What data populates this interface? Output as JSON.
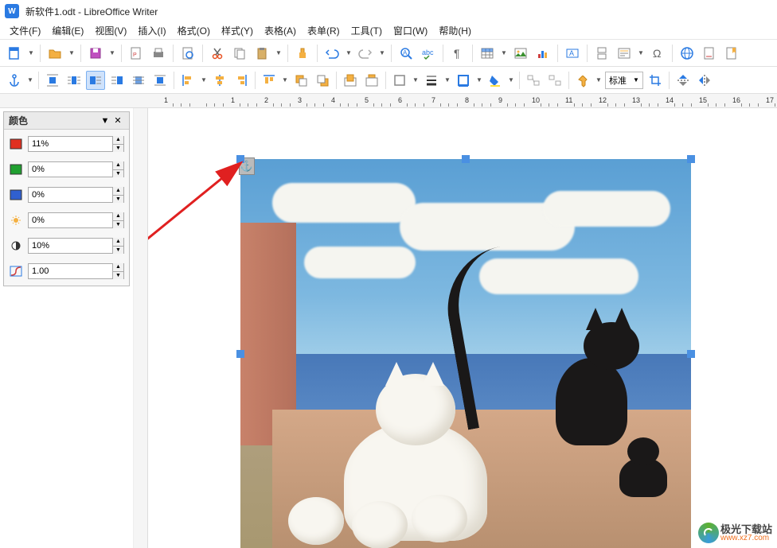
{
  "title": {
    "doc_name": "新软件1.odt",
    "app_name": "LibreOffice Writer",
    "separator": " - "
  },
  "menus": {
    "file": "文件(F)",
    "edit": "编辑(E)",
    "view": "视图(V)",
    "insert": "插入(I)",
    "format": "格式(O)",
    "styles": "样式(Y)",
    "table": "表格(A)",
    "form": "表单(R)",
    "tools": "工具(T)",
    "window": "窗口(W)",
    "help": "帮助(H)"
  },
  "toolbar2": {
    "combo_label": "标准"
  },
  "color_panel": {
    "title": "颜色",
    "red": "11%",
    "green": "0%",
    "blue": "0%",
    "brightness": "0%",
    "contrast": "10%",
    "gamma": "1.00"
  },
  "ruler": {
    "marks": [
      "1",
      "",
      "1",
      "2",
      "3",
      "4",
      "5",
      "6",
      "7",
      "8",
      "9",
      "10",
      "11",
      "12",
      "13",
      "14",
      "15",
      "16",
      "17"
    ]
  },
  "watermark": {
    "name": "极光下载站",
    "url": "www.xz7.com"
  },
  "icons": {
    "app": "W"
  }
}
